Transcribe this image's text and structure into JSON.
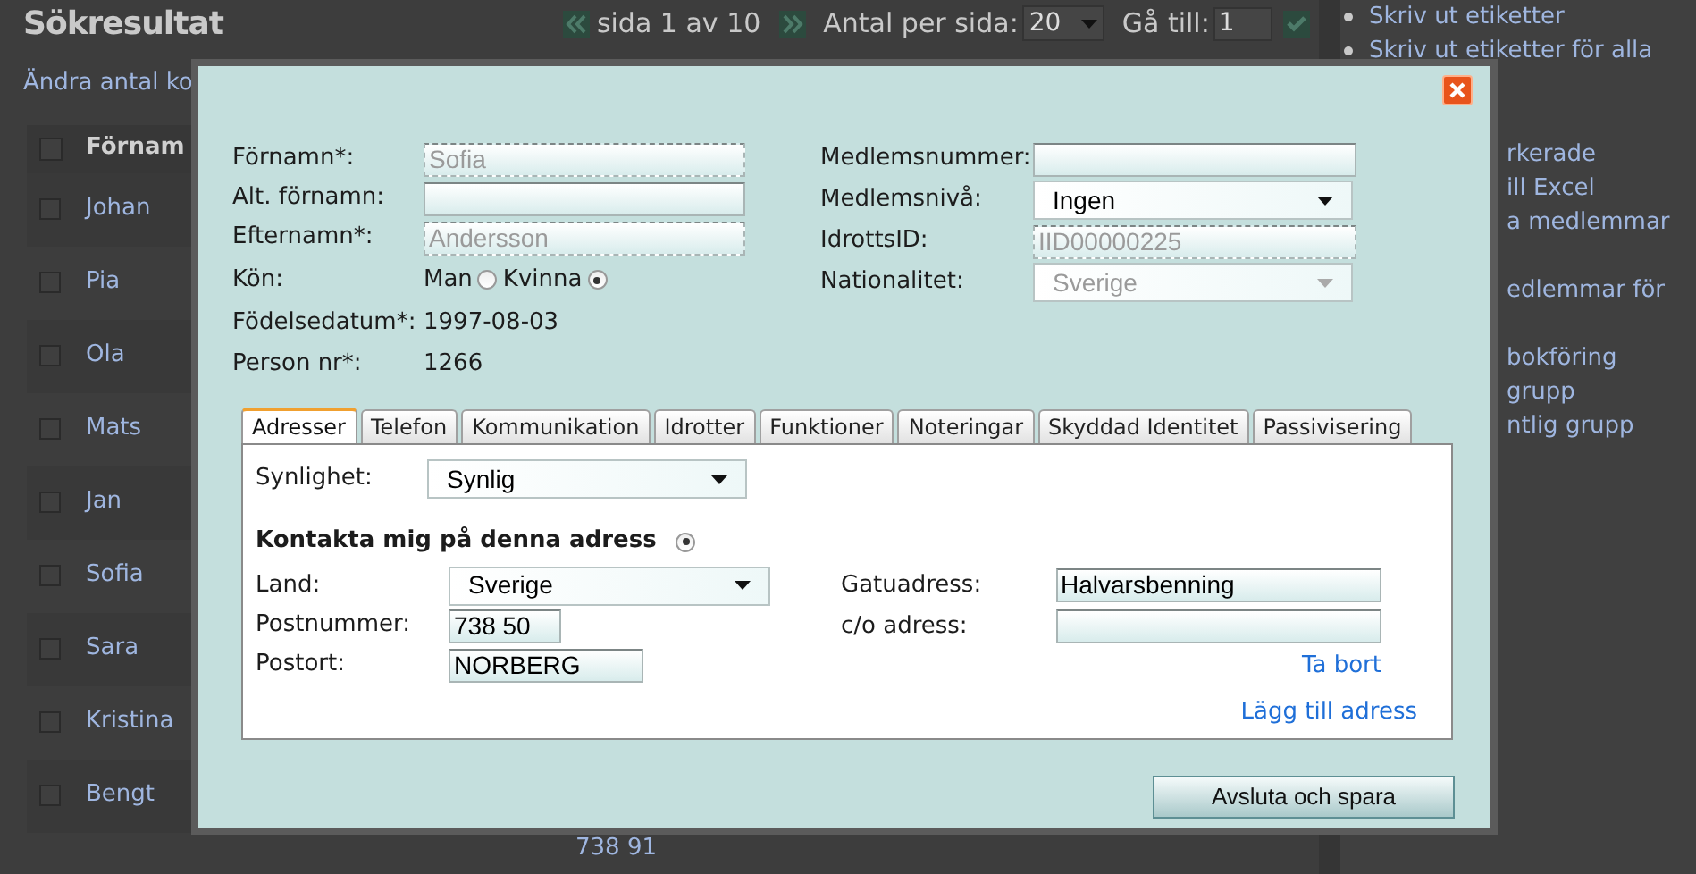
{
  "background_page": {
    "title": "Sökresultat",
    "pager": {
      "page_text": "sida 1 av 10",
      "per_page_label": "Antal per sida:",
      "per_page_value": "20",
      "goto_label": "Gå till:",
      "goto_value": "1"
    },
    "columns_link": "Ändra antal ko",
    "table": {
      "columns": [
        "Förnam"
      ],
      "header_checkbox": {
        "checked": false
      },
      "rows": [
        {
          "first_name": "Johan",
          "checked": false
        },
        {
          "first_name": "Pia",
          "checked": false
        },
        {
          "first_name": "Ola",
          "checked": false
        },
        {
          "first_name": "Mats",
          "checked": false
        },
        {
          "first_name": "Jan",
          "checked": false
        },
        {
          "first_name": "Sofia",
          "checked": false
        },
        {
          "first_name": "Sara",
          "checked": false
        },
        {
          "first_name": "Kristina",
          "checked": false
        },
        {
          "first_name": "Bengt",
          "checked": false
        }
      ],
      "footer_text": "738 91"
    },
    "sidebar": {
      "links": [
        {
          "text": "Skriv ut etiketter",
          "bullet": true
        },
        {
          "text": "Skriv ut etiketter för alla",
          "bullet": true
        },
        {
          "text": "rkerade",
          "bullet": false
        },
        {
          "text": "ill Excel",
          "bullet": false
        },
        {
          "text": "a medlemmar",
          "bullet": false
        },
        {
          "text": "edlemmar för",
          "bullet": false
        },
        {
          "text": "bokföring",
          "bullet": false
        },
        {
          "text": "grupp",
          "bullet": false
        },
        {
          "text": "ntlig grupp",
          "bullet": false
        }
      ]
    }
  },
  "dialog": {
    "person_fields": [
      {
        "kind": "input",
        "label": "Förnamn*:",
        "value": "Sofia",
        "disabled": true
      },
      {
        "kind": "input",
        "label": "Alt. förnamn:",
        "disabled": false
      },
      {
        "kind": "input",
        "label": "Efternamn*:",
        "value": "Andersson",
        "disabled": true
      },
      {
        "kind": "radio",
        "label": "Kön:",
        "options": [
          {
            "label": "Man",
            "selected": false
          },
          {
            "label": "Kvinna",
            "selected": true
          }
        ]
      },
      {
        "kind": "text",
        "label": "Födelsedatum*:",
        "value": "1997-08-03"
      },
      {
        "kind": "text",
        "label": "Person nr*:",
        "value": "1266"
      }
    ],
    "member_fields": [
      {
        "kind": "input",
        "label": "Medlemsnummer:",
        "disabled": false
      },
      {
        "kind": "select",
        "label": "Medlemsnivå:",
        "value": "Ingen",
        "disabled": false
      },
      {
        "kind": "input",
        "label": "IdrottsID:",
        "value": "IID00000225",
        "disabled": true
      },
      {
        "kind": "select",
        "label": "Nationalitet:",
        "value": "Sverige",
        "disabled": true
      }
    ],
    "tabs": [
      {
        "label": "Adresser",
        "selected": true
      },
      {
        "label": "Telefon",
        "selected": false
      },
      {
        "label": "Kommunikation",
        "selected": false
      },
      {
        "label": "Idrotter",
        "selected": false
      },
      {
        "label": "Funktioner",
        "selected": false
      },
      {
        "label": "Noteringar",
        "selected": false
      },
      {
        "label": "Skyddad Identitet",
        "selected": false
      },
      {
        "label": "Passivisering",
        "selected": false
      }
    ],
    "address_panel": {
      "visibility": {
        "label": "Synlighet:",
        "value": "Synlig"
      },
      "contact_here": {
        "label": "Kontakta mig på denna adress",
        "selected": true
      },
      "left_fields": [
        {
          "kind": "select",
          "label": "Land:",
          "value": "Sverige"
        },
        {
          "kind": "input",
          "label": "Postnummer:",
          "value": "738 50"
        },
        {
          "kind": "input",
          "label": "Postort:",
          "value": "NORBERG"
        }
      ],
      "right_fields": [
        {
          "kind": "input",
          "label": "Gatuadress:",
          "value": "Halvarsbenning"
        },
        {
          "kind": "input",
          "label": "c/o adress:"
        }
      ],
      "remove_link": "Ta bort",
      "add_link": "Lägg till adress"
    },
    "save_button": "Avsluta och spara"
  }
}
